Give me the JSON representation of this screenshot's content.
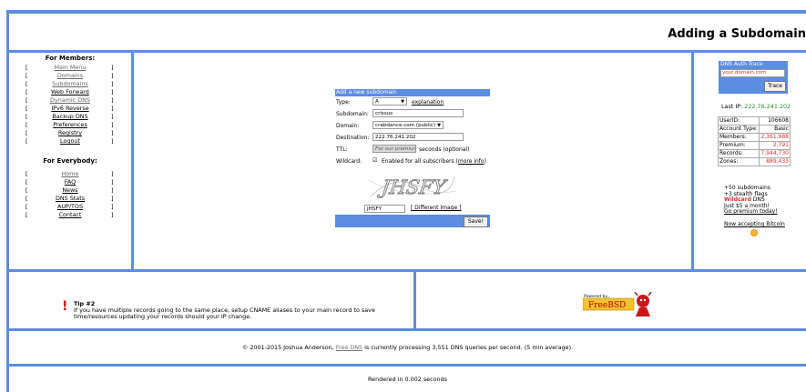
{
  "header": {
    "title": "Adding a Subdomain"
  },
  "nav": {
    "members_title": "For Members:",
    "members": [
      {
        "label": "Main Menu",
        "visited": true
      },
      {
        "label": "Domains",
        "visited": true
      },
      {
        "label": "Subdomains",
        "visited": true
      },
      {
        "label": "Web Forward",
        "visited": false
      },
      {
        "label": "Dynamic DNS",
        "visited": true
      },
      {
        "label": "IPv6 Reverse",
        "visited": false
      },
      {
        "label": "Backup DNS",
        "visited": false
      },
      {
        "label": "Preferences",
        "visited": false
      },
      {
        "label": "Registry",
        "visited": false
      },
      {
        "label": "Logout",
        "visited": false
      }
    ],
    "everybody_title": "For Everybody:",
    "everybody": [
      {
        "label": "Home",
        "visited": true
      },
      {
        "label": "FAQ",
        "visited": false
      },
      {
        "label": "News",
        "visited": false
      },
      {
        "label": "DNS Stats",
        "visited": false
      },
      {
        "label": "AUP/TOS",
        "visited": false
      },
      {
        "label": "Contact",
        "visited": false
      }
    ],
    "bracket_open": "[",
    "bracket_close": "]"
  },
  "form": {
    "title": "Add a new subdomain",
    "type_label": "Type:",
    "type_value": "A",
    "type_help": "explanation",
    "subdomain_label": "Subdomain:",
    "subdomain_value": "crissus",
    "domain_label": "Domain:",
    "domain_value": "crabdance.com (public)",
    "destination_label": "Destination:",
    "destination_value": "222.76.241.202",
    "ttl_label": "TTL:",
    "ttl_placeholder": "For our premium suppor",
    "ttl_suffix": "seconds (optional)",
    "wildcard_label": "Wildcard:",
    "wildcard_text": "Enabled for all subscribers (",
    "wildcard_link": "more info",
    "wildcard_close": ")",
    "captcha_text": "JHSFY",
    "captcha_input": "JHSFY",
    "captcha_link": "[ Different Image ]",
    "save_label": "Save!"
  },
  "dns_trace": {
    "title": "DNS Auth Trace",
    "placeholder": "your.domain.com",
    "button": "Trace"
  },
  "account": {
    "last_ip_label": "Last IP:",
    "last_ip": "222.76.241.202",
    "rows": [
      {
        "label": "UserID:",
        "value": "106608",
        "red": false
      },
      {
        "label": "Account Type:",
        "value": "Basic",
        "red": false
      },
      {
        "label": "Members:",
        "value": "2,361,988",
        "red": true
      },
      {
        "label": "Premium:",
        "value": "2,791",
        "red": true
      },
      {
        "label": "Records:",
        "value": "7,944,730",
        "red": true
      },
      {
        "label": "Zones:",
        "value": "889,433",
        "red": true
      }
    ]
  },
  "promo": {
    "line1": "+50 subdomains",
    "line2": "+3 stealth flags",
    "wildcard_word": "Wildcard",
    "line3_rest": " DNS",
    "line4": "Just $5 a month!",
    "link": "Go premium today!",
    "bitcoin": "Now accepting Bitcoin"
  },
  "tip": {
    "title": "Tip #2",
    "text": "If you have multiple records going to the same place, setup CNAME aliases to your main record to save time/resources updating your records should your IP change."
  },
  "freebsd": {
    "powered": "Powered by...",
    "name": "FreeBSD"
  },
  "footer": {
    "copy_prefix": "© 2001-2015 Joshua Anderson, ",
    "copy_link": "Free DNS",
    "copy_suffix": " is currently processing 3,551 DNS queries per second. (5 min average).",
    "render": "Rendered in 0.002 seconds"
  },
  "colors": {
    "frame": "#5b8de0",
    "red": "#c33",
    "green": "#2a8a2a"
  }
}
